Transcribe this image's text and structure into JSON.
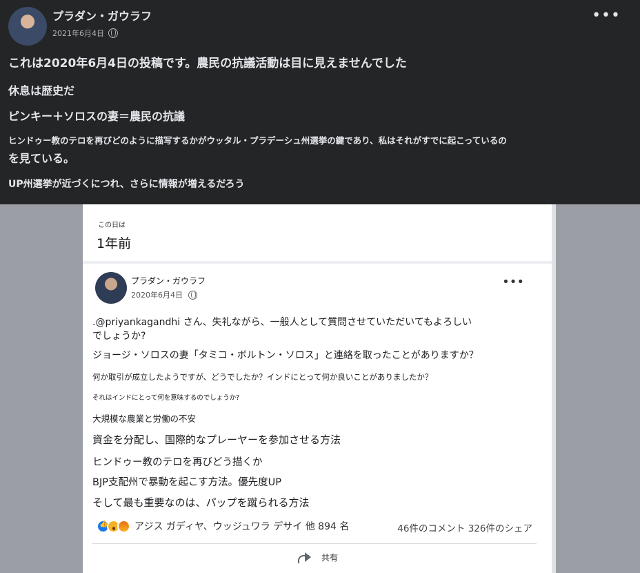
{
  "outer_post": {
    "author": "プラダン・ガウラフ",
    "date": "2021年6月4日",
    "lines": [
      "これは2020年6月4日の投稿です。農民の抗議活動は目に見えませんでした",
      "休息は歴史だ",
      "ピンキー＋ソロスの妻＝農民の抗議",
      "ヒンドゥー教のテロを再びどのように描写するかがウッタル・プラデーシュ州選挙の鍵であり、私はそれがすでに起こっているの",
      "を見ている。",
      "UP州選挙が近づくにつれ、さらに情報が増えるだろう"
    ]
  },
  "memory": {
    "label": "この日は",
    "title": "1年前"
  },
  "inner_post": {
    "author": "プラダン・ガウラフ",
    "date": "2020年6月4日",
    "lines": [
      ".@priyankagandhi さん、失礼ながら、一般人として質問させていただいてもよろしい",
      "でしょうか?",
      "ジョージ・ソロスの妻「タミコ・ボルトン・ソロス」と連絡を取ったことがありますか？",
      "何か取引が成立したようですが、どうでしたか？インドにとって何か良いことがありましたか？",
      "それはインドにとって何を意味するのでしょうか?",
      "大規模な農業と労働の不安",
      "資金を分配し、国際的なプレーヤーを参加させる方法",
      "ヒンドゥー教のテロを再びどう描くか",
      "BJP支配州で暴動を起こす方法。優先度UP",
      "そして最も重要なのは、パップを蹴られる方法"
    ],
    "reactions_text": "アジス ガディヤ、ウッジュワラ デサイ 他 894 名",
    "stats": "46件のコメント 326件のシェア",
    "share_label": "共有"
  }
}
